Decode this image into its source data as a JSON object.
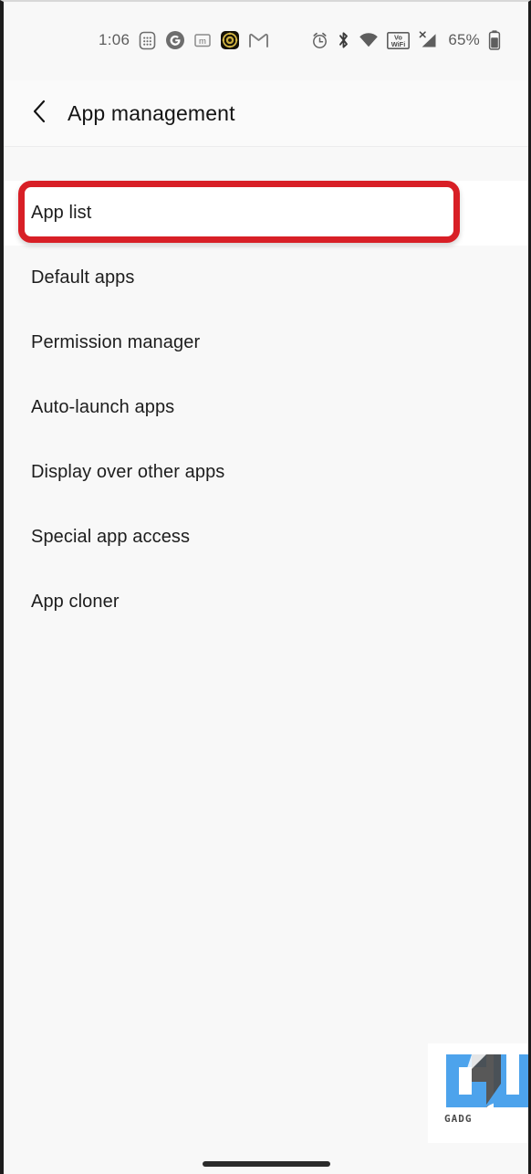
{
  "statusbar": {
    "time": "1:06",
    "battery_percent": "65%",
    "left_icons": [
      {
        "name": "keypad-app-icon",
        "label": "keypad"
      },
      {
        "name": "google-app-icon",
        "label": "G"
      },
      {
        "name": "m-app-icon",
        "label": "m"
      },
      {
        "name": "gold-emblem-app-icon",
        "label": "emblem"
      },
      {
        "name": "gmail-app-icon",
        "label": "M"
      }
    ],
    "right_icons": [
      {
        "name": "alarm-clock-icon",
        "label": "alarm"
      },
      {
        "name": "bluetooth-icon",
        "label": "bluetooth"
      },
      {
        "name": "wifi-icon",
        "label": "wifi"
      },
      {
        "name": "volte-wifi-icon",
        "label": "VoWiFi"
      },
      {
        "name": "signal-no-service-icon",
        "label": "signal"
      },
      {
        "name": "battery-icon",
        "label": "battery"
      }
    ]
  },
  "header": {
    "back_icon": "chevron-left-icon",
    "title": "App management"
  },
  "list": {
    "items": [
      {
        "label": "App list",
        "highlighted": true
      },
      {
        "label": "Default apps",
        "highlighted": false
      },
      {
        "label": "Permission manager",
        "highlighted": false
      },
      {
        "label": "Auto-launch apps",
        "highlighted": false
      },
      {
        "label": "Display over other apps",
        "highlighted": false
      },
      {
        "label": "Special app access",
        "highlighted": false
      },
      {
        "label": "App cloner",
        "highlighted": false
      }
    ]
  },
  "annotation": {
    "highlight_color": "#d81f26",
    "target_label": "App list"
  },
  "watermark": {
    "logo_text": "GU",
    "caption": "GADG",
    "logo_color": "#4da3ec",
    "logo_shadow_color": "#4a4a4a"
  },
  "navbar": {
    "gesture_pill": "home-gesture-pill"
  },
  "theme": {
    "background": "#f8f8f8",
    "header_background": "#fafafa",
    "text_primary": "#1d1d1d",
    "text_secondary": "#5d5d5d"
  }
}
